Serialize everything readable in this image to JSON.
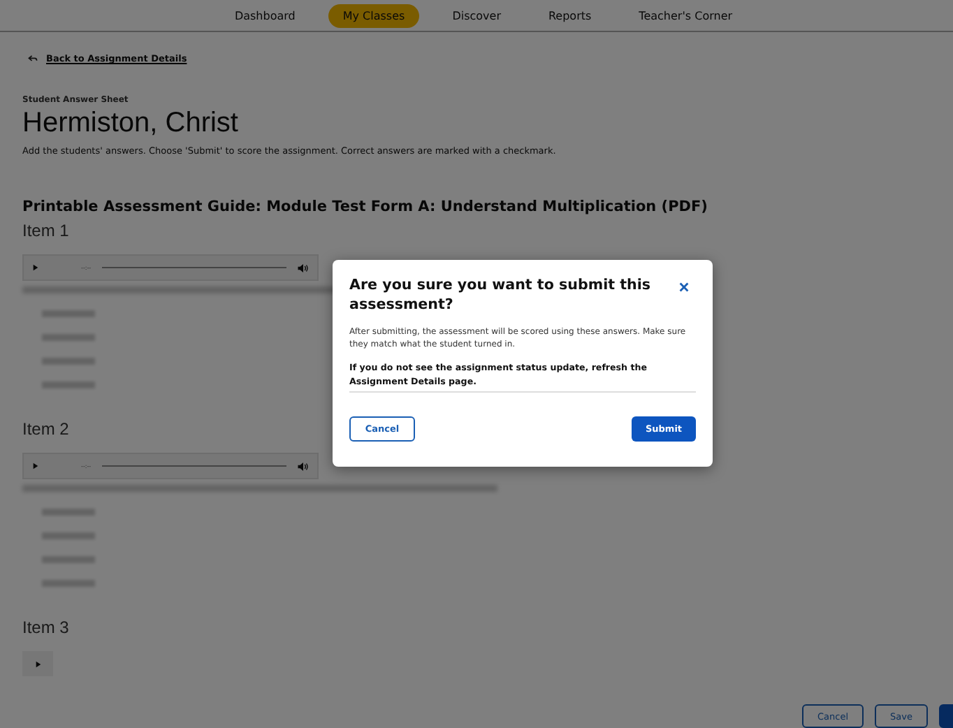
{
  "nav": [
    {
      "label": "Dashboard",
      "selected": false
    },
    {
      "label": "My Classes",
      "selected": true
    },
    {
      "label": "Discover",
      "selected": false
    },
    {
      "label": "Reports",
      "selected": false
    },
    {
      "label": "Teacher's Corner",
      "selected": false
    }
  ],
  "back_link": "Back to Assignment Details",
  "eyebrow": "Student Answer Sheet",
  "student_name": "Hermiston, Christ",
  "instructions": "Add the students' answers. Choose 'Submit' to score the assignment. Correct answers are marked with a checkmark.",
  "guide_title": "Printable Assessment Guide: Module Test Form A: Understand Multiplication (PDF)",
  "items": [
    {
      "label": "Item 1",
      "kind": "full",
      "time": "--:--"
    },
    {
      "label": "Item 2",
      "kind": "full",
      "time": "--:--"
    },
    {
      "label": "Item 3",
      "kind": "cut_off"
    }
  ],
  "footer_buttons": [
    {
      "label": "Cancel",
      "kind": "outline"
    },
    {
      "label": "Save",
      "kind": "outline"
    },
    {
      "kind": "primary"
    }
  ],
  "dialog": {
    "title": "Are you sure you want to submit this assessment?",
    "message": "After submitting, the assessment will be scored using these answers. Make sure they match what the student turned in.",
    "note": "If you do not see the assignment status update, refresh the Assignment Details page.",
    "cancel": "Cancel",
    "submit": "Submit"
  }
}
